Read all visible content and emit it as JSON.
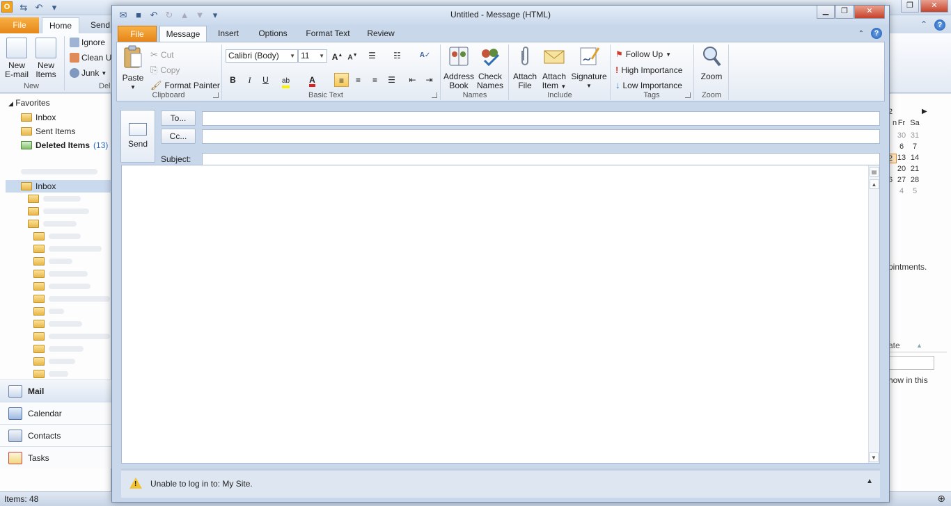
{
  "colors": {
    "file_tab": "#e8891b",
    "accent": "#2b6ac2",
    "close": "#c6402a"
  },
  "background": {
    "file_tab": "File",
    "tabs": [
      "Home",
      "Send"
    ],
    "ribbon": {
      "new_email": "New\nE-mail",
      "new_email_l1": "New",
      "new_email_l2": "E-mail",
      "new_items_l1": "New",
      "new_items_l2": "Items",
      "ignore": "Ignore",
      "clean_up": "Clean U",
      "junk": "Junk",
      "group_new": "New",
      "group_delete": "Del"
    },
    "nav": {
      "favorites": "Favorites",
      "fav_inbox": "Inbox",
      "fav_sent": "Sent Items",
      "fav_deleted": "Deleted Items",
      "fav_deleted_count": "(13)",
      "inbox": "Inbox"
    },
    "nav_buttons": [
      "Mail",
      "Calendar",
      "Contacts",
      "Tasks"
    ],
    "todo": {
      "cal_row0": [
        "n",
        "Fr",
        "Sa"
      ],
      "cal_row1": [
        "",
        "30",
        "31"
      ],
      "cal_row2": [
        "",
        "6",
        "7"
      ],
      "cal_row3": [
        "2",
        "13",
        "14"
      ],
      "cal_row4": [
        "",
        "20",
        "21"
      ],
      "cal_row5": [
        "6",
        "27",
        "28"
      ],
      "cal_row6": [
        "",
        "4",
        "5"
      ],
      "appointments": "pintments.",
      "col_header": "ate",
      "show_in_this": "how in this",
      "month_digit": "2"
    },
    "status": "Items: 48"
  },
  "message": {
    "title": "Untitled  -  Message (HTML)",
    "tabs": {
      "file": "File",
      "message": "Message",
      "insert": "Insert",
      "options": "Options",
      "format_text": "Format Text",
      "review": "Review"
    },
    "ribbon": {
      "paste": "Paste",
      "cut": "Cut",
      "copy": "Copy",
      "format_painter": "Format Painter",
      "clipboard": "Clipboard",
      "font_name": "Calibri (Body)",
      "font_size": "11",
      "bold": "B",
      "italic": "I",
      "underline": "U",
      "basic_text": "Basic Text",
      "address_l1": "Address",
      "address_l2": "Book",
      "check_l1": "Check",
      "check_l2": "Names",
      "names": "Names",
      "attach_file_l1": "Attach",
      "attach_file_l2": "File",
      "attach_item_l1": "Attach",
      "attach_item_l2": "Item",
      "signature": "Signature",
      "include": "Include",
      "follow_up": "Follow Up",
      "high_importance": "High Importance",
      "low_importance": "Low Importance",
      "tags": "Tags",
      "zoom": "Zoom",
      "zoom_group": "Zoom"
    },
    "header": {
      "send": "Send",
      "to": "To...",
      "cc": "Cc...",
      "subject_label": "Subject:",
      "to_value": "",
      "cc_value": "",
      "subject_value": ""
    },
    "infobar": "Unable to log in to: My Site."
  }
}
